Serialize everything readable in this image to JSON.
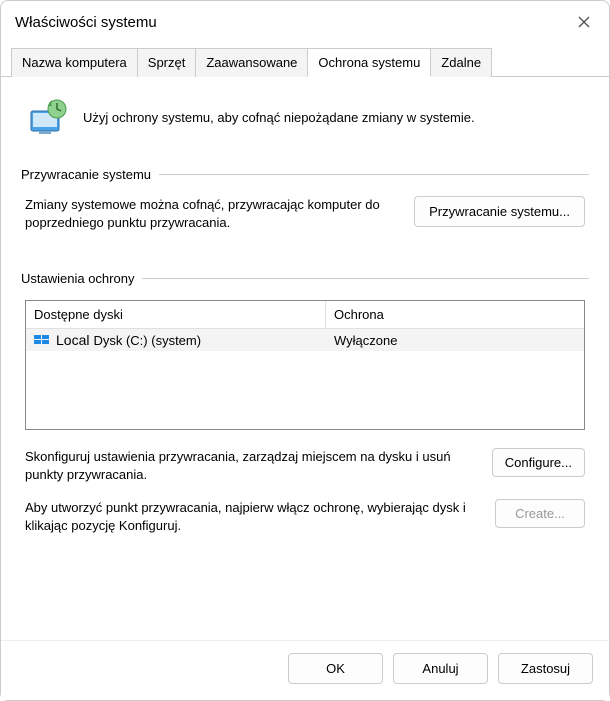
{
  "window_title": "Właściwości systemu",
  "tabs": {
    "computer_name": "Nazwa komputera",
    "hardware": "Sprzęt",
    "advanced": "Zaawansowane",
    "protection": "Ochrona systemu",
    "remote": "Zdalne"
  },
  "intro_text": "Użyj ochrony systemu, aby cofnąć niepożądane zmiany w systemie.",
  "group_restore": "Przywracanie systemu",
  "restore_text": "Zmiany systemowe można cofnąć, przywracając komputer do poprzedniego punktu przywracania.",
  "btn_restore": "Przywracanie systemu...",
  "group_protection": "Ustawienia ochrony",
  "col_drives": "Dostępne dyski",
  "col_protection": "Ochrona",
  "drive_local_prefix": "Local",
  "drive_name": "Dysk (C:) (system)",
  "drive_status": "Wyłączone",
  "config_text": "Skonfiguruj ustawienia przywracania, zarządzaj miejscem na dysku i usuń punkty przywracania.",
  "btn_configure": "Configure...",
  "create_text": "Aby utworzyć punkt przywracania, najpierw włącz ochronę, wybierając dysk i klikając pozycję Konfiguruj.",
  "btn_create": "Create...",
  "btn_ok": "OK",
  "btn_cancel": "Anuluj",
  "btn_apply": "Zastosuj"
}
